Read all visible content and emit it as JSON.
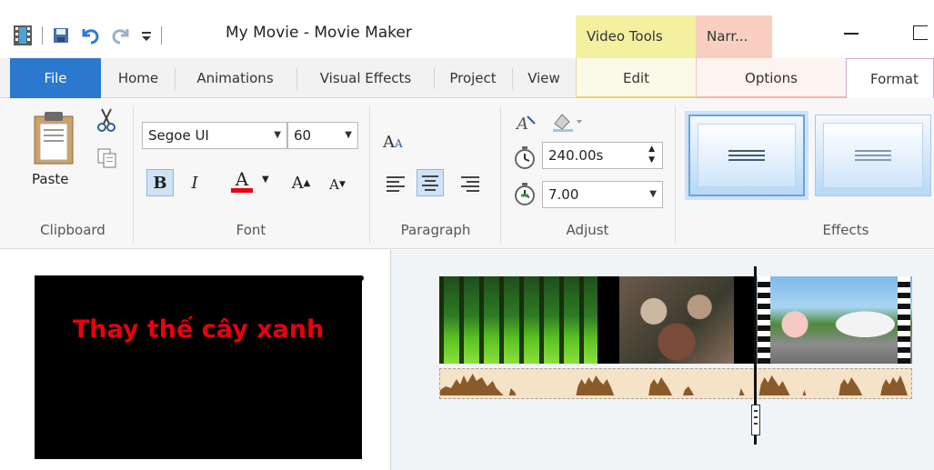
{
  "window": {
    "title": "My Movie - Movie Maker",
    "context_tab_video_tools": "Video Tools",
    "context_tab_narration": "Narr..."
  },
  "tabs": [
    {
      "label": "File"
    },
    {
      "label": "Home"
    },
    {
      "label": "Animations"
    },
    {
      "label": "Visual Effects"
    },
    {
      "label": "Project"
    },
    {
      "label": "View"
    },
    {
      "label": "Edit"
    },
    {
      "label": "Options"
    },
    {
      "label": "Format"
    }
  ],
  "ribbon": {
    "clipboard": {
      "paste_label": "Paste",
      "group_label": "Clipboard"
    },
    "font": {
      "family": "Segoe UI",
      "size": "60",
      "bold_glyph": "B",
      "italic_glyph": "I",
      "color_glyph": "A",
      "grow_glyph": "A",
      "shrink_glyph": "A",
      "group_label": "Font"
    },
    "paragraph": {
      "group_label": "Paragraph"
    },
    "adjust": {
      "duration": "240.00s",
      "start_time": "7.00",
      "group_label": "Adjust"
    },
    "effects": {
      "group_label": "Effects"
    }
  },
  "preview": {
    "caption_text": "Thay thế cây xanh"
  },
  "colors": {
    "file_tab": "#2b78cf",
    "video_tools": "#f3f0a0",
    "narration": "#f8cfc1",
    "caption_text": "#e8000f",
    "audio_track": "#f6e2c6"
  }
}
